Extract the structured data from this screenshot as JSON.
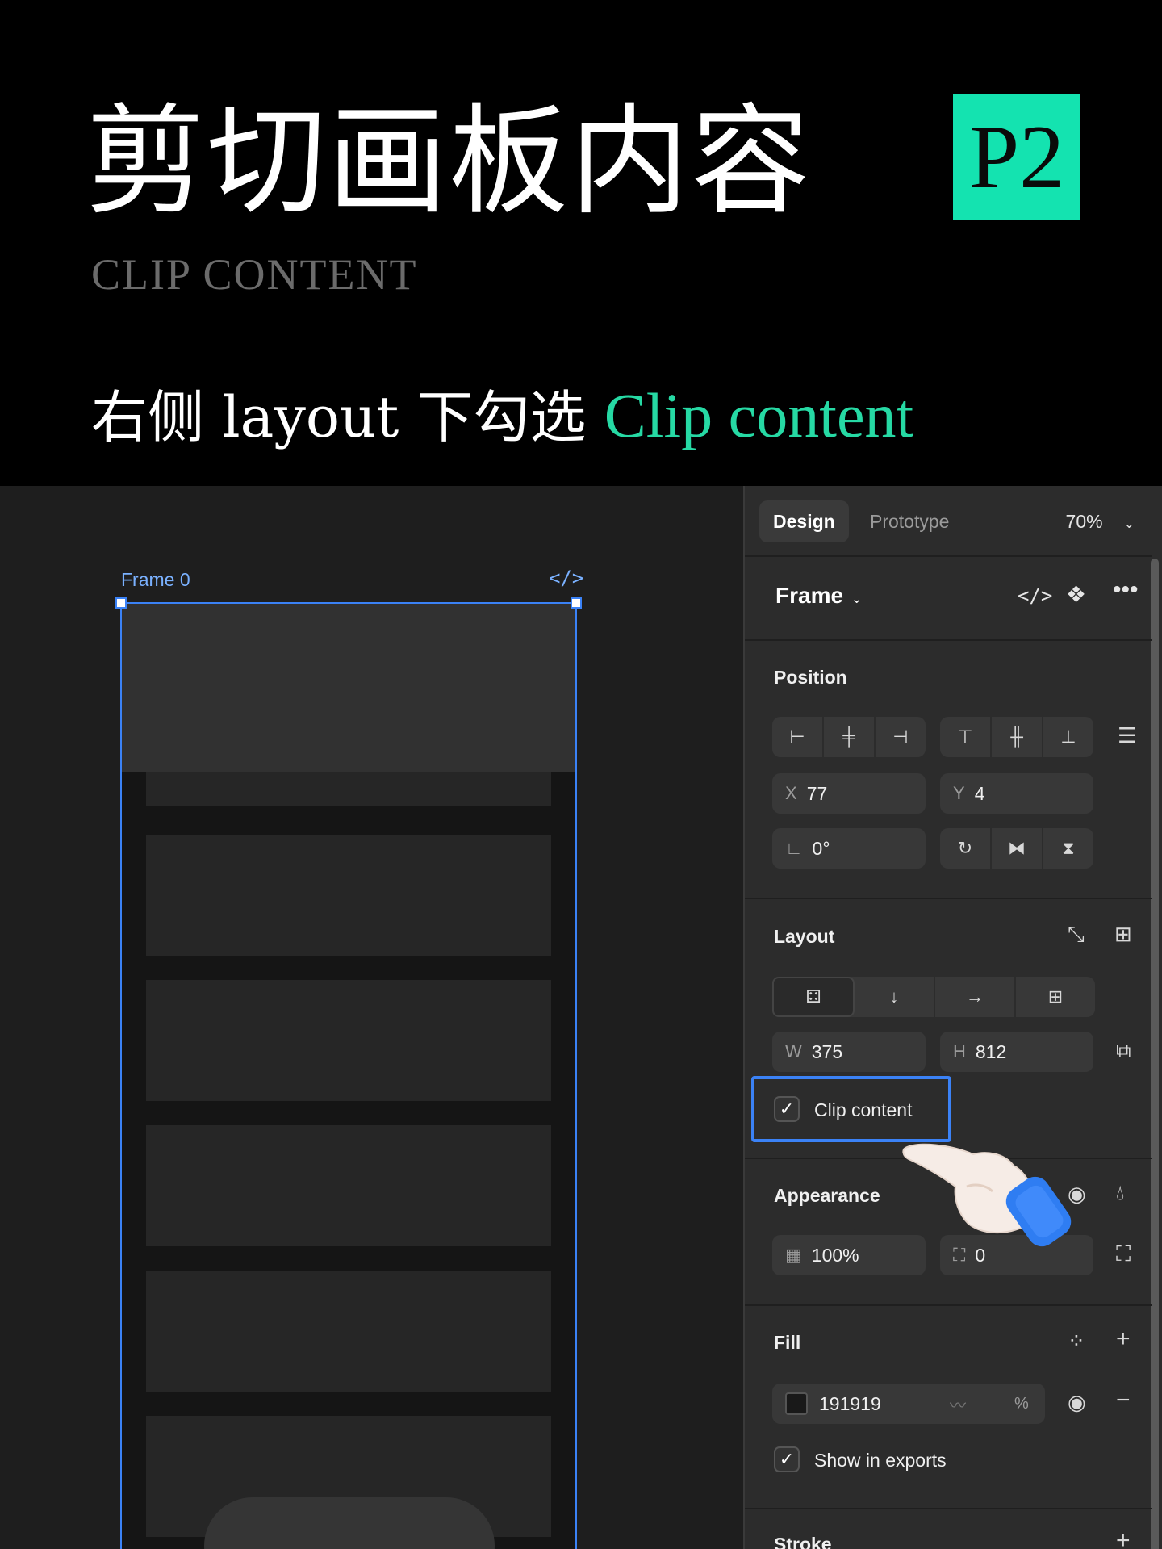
{
  "header": {
    "title_cn": "剪切画板内容",
    "title_en": "CLIP CONTENT",
    "badge": "P2",
    "subtitle_prefix": "右侧 layout 下勾选 ",
    "subtitle_highlight": "Clip content",
    "accent_color": "#14e3b0"
  },
  "canvas": {
    "frame_label": "Frame 0",
    "frame_code_icon": "</>"
  },
  "panel": {
    "tabs": [
      {
        "label": "Design",
        "active": true
      },
      {
        "label": "Prototype",
        "active": false
      }
    ],
    "zoom": "70%",
    "frame_title": "Frame",
    "position": {
      "title": "Position",
      "x_label": "X",
      "x_value": "77",
      "y_label": "Y",
      "y_value": "4",
      "rotation_value": "0°"
    },
    "layout": {
      "title": "Layout",
      "w_label": "W",
      "w_value": "375",
      "h_label": "H",
      "h_value": "812",
      "clip_content_label": "Clip content",
      "clip_content_checked": true
    },
    "appearance": {
      "title": "Appearance",
      "opacity": "100%",
      "radius": "0"
    },
    "fill": {
      "title": "Fill",
      "color_hex": "191919",
      "percent_symbol": "%",
      "show_in_exports_label": "Show in exports",
      "show_in_exports_checked": true
    },
    "stroke": {
      "title": "Stroke"
    }
  }
}
